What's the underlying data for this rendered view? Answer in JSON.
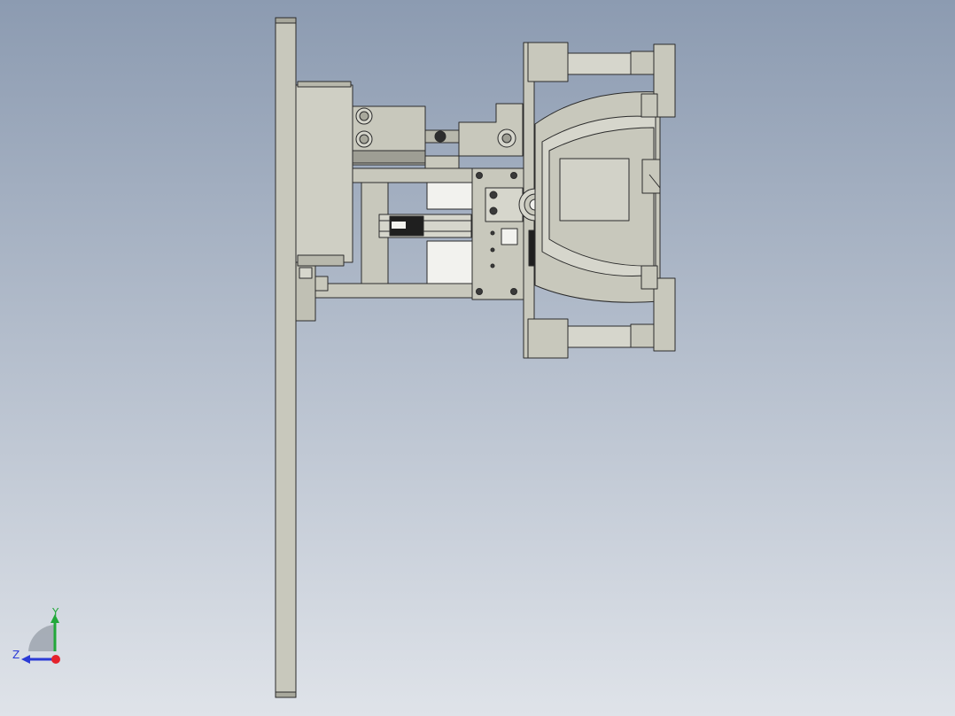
{
  "viewport": {
    "background_top": "#8c9bb1",
    "background_bottom": "#dfe3e9"
  },
  "model": {
    "part_fill": "#c8c8bc",
    "part_fill_light": "#d6d6cc",
    "part_fill_dark": "#a8a89c",
    "edge_color": "#2b2b2b",
    "white_fill": "#f2f2ee"
  },
  "triad": {
    "x_color": "#e5222c",
    "y_color": "#22a83a",
    "z_color": "#2b3bd6",
    "y_label": "Y",
    "z_label": "Z"
  }
}
